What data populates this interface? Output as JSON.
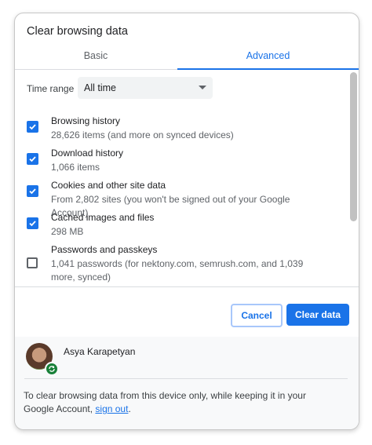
{
  "dialog": {
    "title": "Clear browsing data",
    "tabs": [
      {
        "label": "Basic"
      },
      {
        "label": "Advanced"
      }
    ],
    "time_range": {
      "label": "Time range",
      "value": "All time"
    },
    "items": [
      {
        "title": "Browsing history",
        "detail": "28,626 items (and more on synced devices)",
        "checked": true
      },
      {
        "title": "Download history",
        "detail": "1,066 items",
        "checked": true
      },
      {
        "title": "Cookies and other site data",
        "detail": "From 2,802 sites (you won't be signed out of your Google Account)",
        "checked": true
      },
      {
        "title": "Cached images and files",
        "detail": "298 MB",
        "checked": true
      },
      {
        "title": "Passwords and passkeys",
        "detail": "1,041 passwords (for nektony.com, semrush.com, and 1,039 more, synced)",
        "checked": false
      }
    ],
    "buttons": {
      "cancel": "Cancel",
      "clear": "Clear data"
    },
    "account": {
      "name": "Asya Karapetyan"
    },
    "footer": {
      "text": "To clear browsing data from this device only, while keeping it in your Google Account,",
      "link": "sign out",
      "end": "."
    }
  },
  "colors": {
    "accent": "#1a73e8",
    "sync_badge": "#188038"
  }
}
